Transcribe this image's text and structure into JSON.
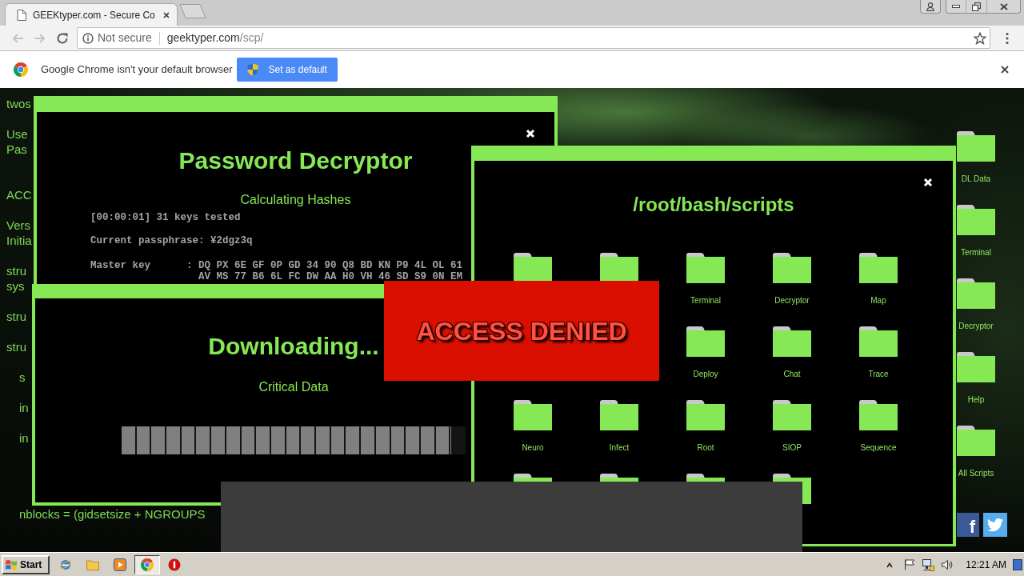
{
  "browser": {
    "tab": {
      "title": "GEEKtyper.com - Secure Co"
    },
    "address_bar": {
      "security": "Not secure",
      "host": "geektyper.com",
      "path": "/scp/"
    },
    "infobar": {
      "message": "Google Chrome isn't your default browser",
      "button": "Set as default"
    }
  },
  "background_text": [
    {
      "lines": [
        "twos"
      ]
    },
    {
      "lines": [
        "Use",
        "Pas"
      ]
    },
    {
      "lines": [
        "ACC"
      ]
    },
    {
      "lines": [
        "Vers",
        "Initia"
      ]
    },
    {
      "lines": [
        "stru",
        "sys"
      ]
    },
    {
      "lines": [
        "stru"
      ]
    },
    {
      "lines": [
        "stru"
      ],
      "children": [
        {
          "lines": [
            "s"
          ]
        },
        {
          "lines": [
            "in"
          ]
        },
        {
          "lines": [
            "in"
          ]
        },
        {
          "lines": [
            "nblocks = (gidsetsize + NGROUPS"
          ]
        }
      ]
    }
  ],
  "decryptor_window": {
    "title": "Password Decryptor",
    "subtitle": "Calculating Hashes",
    "log": [
      {
        "kind": "line",
        "text": "[00:00:01] 31 keys tested"
      },
      {
        "kind": "line",
        "text": "Current passphrase: ¥2dgz3q"
      },
      {
        "kind": "line",
        "text": "Master key      : DQ PX 6E GF 0P GD 34 90 Q8 BD KN P9 4L OL 61"
      },
      {
        "kind": "continuation",
        "text": "AV MS 77 B6 6L FC DW AA H0 VH 46 SD S9 0N EM"
      }
    ]
  },
  "download_window": {
    "title": "Downloading...",
    "subtitle": "Critical Data",
    "progress": {
      "level": 0.957
    }
  },
  "scripts_window": {
    "title": "/root/bash/scripts",
    "folders": [
      {
        "kind": "folder"
      },
      {
        "kind": "folder"
      },
      {
        "kind": "folder",
        "label": "Terminal"
      },
      {
        "kind": "folder",
        "label": "Decryptor"
      },
      {
        "kind": "folder",
        "label": "Map"
      },
      {
        "kind": "folder",
        "label": "Deploy"
      },
      {
        "kind": "folder",
        "label": "Chat"
      },
      {
        "kind": "folder",
        "label": "Trace"
      },
      {
        "kind": "folder",
        "label": "Neuro"
      },
      {
        "kind": "folder",
        "label": "Infect"
      },
      {
        "kind": "folder",
        "label": "Root"
      },
      {
        "kind": "folder",
        "label": "SIOP"
      },
      {
        "kind": "folder",
        "label": "Sequence"
      },
      {
        "kind": "folder"
      },
      {
        "kind": "folder"
      },
      {
        "kind": "folder"
      },
      {
        "kind": "folder"
      }
    ]
  },
  "alert": {
    "text": "ACCESS DENIED"
  },
  "sidebar": {
    "items": [
      {
        "label": "DL Data"
      },
      {
        "label": "Terminal"
      },
      {
        "label": "Decryptor"
      },
      {
        "label": "Help"
      },
      {
        "label": "All Scripts"
      }
    ]
  },
  "social": [
    {
      "kind": "letter",
      "text": "f"
    },
    {
      "kind": "bird"
    }
  ],
  "taskbar": {
    "start": "Start",
    "apps": [
      {
        "kind": "globe",
        "selected": false
      },
      {
        "kind": "folder",
        "selected": false
      },
      {
        "kind": "player",
        "selected": false
      },
      {
        "kind": "browser",
        "selected": true
      },
      {
        "kind": "stop",
        "selected": false
      }
    ],
    "clock": "12:21 AM"
  }
}
